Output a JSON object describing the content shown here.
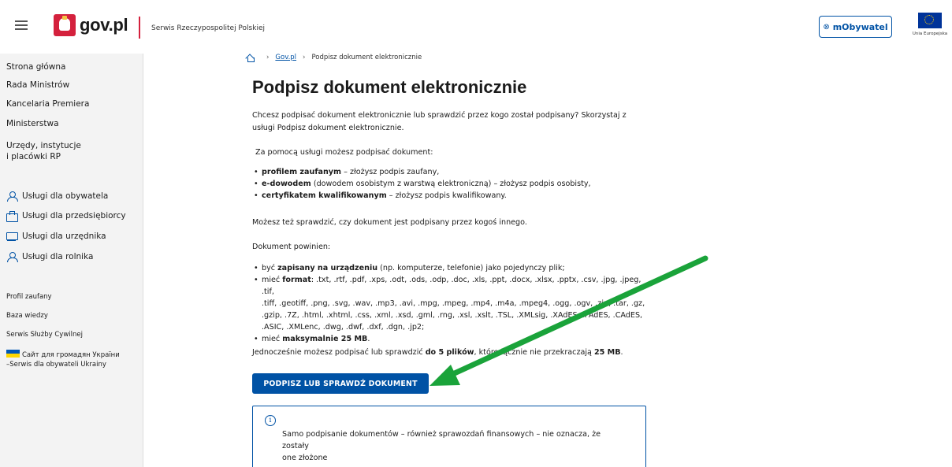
{
  "header": {
    "logo_text": "gov.pl",
    "subtitle": "Serwis Rzeczypospolitej Polskiej",
    "mobywatel_label": "mObywatel",
    "eu_label": "Unia Europejska"
  },
  "sidebar": {
    "nav": [
      "Strona główna",
      "Rada Ministrów",
      "Kancelaria Premiera",
      "Ministerstwa",
      "Urzędy, instytucje",
      "i placówki RP"
    ],
    "services": [
      {
        "label": "Usługi dla obywatela",
        "icon": "person-icon"
      },
      {
        "label": "Usługi dla przedsiębiorcy",
        "icon": "briefcase-icon"
      },
      {
        "label": "Usługi dla urzędnika",
        "icon": "monitor-icon"
      },
      {
        "label": "Usługi dla rolnika",
        "icon": "person-icon"
      }
    ],
    "links": [
      "Profil zaufany",
      "Baza wiedzy",
      "Serwis Służby Cywilnej"
    ],
    "ukraine_line1": "Сайт для громадян України",
    "ukraine_line2": "–Serwis dla obywateli Ukrainy"
  },
  "breadcrumb": {
    "home_label": "",
    "sep": "›",
    "link": "Gov.pl",
    "current": "Podpisz dokument elektronicznie"
  },
  "main": {
    "title": "Podpisz dokument elektronicznie",
    "intro_line1": "Chcesz podpisać dokument elektronicznie lub sprawdzić przez kogo został podpisany? Skorzystaj z",
    "intro_line2": "usługi Podpisz dokument elektronicznie.",
    "methods_intro": "Za pomocą usługi możesz podpisać dokument:",
    "methods": [
      {
        "bold": "profilem zaufanym",
        "rest": " – złożysz podpis zaufany,"
      },
      {
        "bold": "e-dowodem",
        "rest": " (dowodem osobistym z warstwą elektroniczną) – złożysz podpis osobisty,"
      },
      {
        "bold": "certyfikatem kwalifikowanym",
        "rest": " – złożysz podpis kwalifikowany."
      }
    ],
    "check_text": "Możesz też sprawdzić, czy dokument jest podpisany przez kogoś innego.",
    "req_intro": "Dokument powinien:",
    "req1_pre": "być ",
    "req1_bold": "zapisany na urządzeniu",
    "req1_rest": " (np. komputerze, telefonie) jako pojedynczy plik;",
    "req2_pre": "mieć ",
    "req2_bold": "format",
    "req2_line1": ": .txt, .rtf, .pdf, .xps, .odt, .ods, .odp, .doc, .xls, .ppt, .docx, .xlsx, .pptx, .csv, .jpg, .jpeg, .tif,",
    "req2_line2": ".tiff, .geotiff, .png, .svg, .wav, .mp3, .avi, .mpg, .mpeg, .mp4, .m4a, .mpeg4, .ogg, .ogv, .zip, .tar, .gz,",
    "req2_line3": ".gzip, .7Z, .html, .xhtml, .css, .xml, .xsd, .gml, .rng, .xsl, .xslt, .TSL, .XMLsig, .XAdES, .PAdES, .CAdES,",
    "req2_line4": ".ASIC, .XMLenc, .dwg, .dwf, .dxf, .dgn, .jp2;",
    "req3_pre": "mieć ",
    "req3_bold": "maksymalnie 25 MB",
    "req3_rest": ".",
    "limit_pre": "Jednocześnie możesz podpisać lub sprawdzić ",
    "limit_bold1": "do 5 plików",
    "limit_mid": ", które łącznie nie przekraczają ",
    "limit_bold2": "25 MB",
    "limit_end": ".",
    "cta_label": "PODPISZ LUB SPRAWDŹ DOKUMENT",
    "info_icon_glyph": "i",
    "info_line1": "Samo podpisanie dokumentów – również sprawozdań finansowych – nie oznacza, że zostały",
    "info_line2": "one złożone"
  },
  "colors": {
    "brand_blue": "#0052a5",
    "brand_red": "#d4213d",
    "arrow_green": "#1aa33a"
  }
}
